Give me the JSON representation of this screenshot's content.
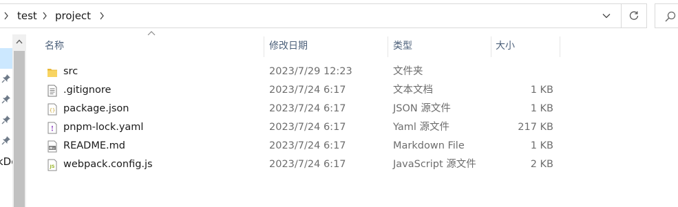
{
  "breadcrumb": {
    "items": [
      "test",
      "project"
    ]
  },
  "columns": {
    "name": "名称",
    "date_modified": "修改日期",
    "type": "类型",
    "size": "大小"
  },
  "nav": {
    "partial_label": "kDo"
  },
  "files": [
    {
      "name": "src",
      "date": "2023/7/29 12:23",
      "type": "文件夹",
      "size": "",
      "icon": "folder-icon"
    },
    {
      "name": ".gitignore",
      "date": "2023/7/24 6:17",
      "type": "文本文档",
      "size": "1 KB",
      "icon": "text-file-icon"
    },
    {
      "name": "package.json",
      "date": "2023/7/24 6:17",
      "type": "JSON 源文件",
      "size": "1 KB",
      "icon": "json-file-icon"
    },
    {
      "name": "pnpm-lock.yaml",
      "date": "2023/7/24 6:17",
      "type": "Yaml 源文件",
      "size": "217 KB",
      "icon": "yaml-file-icon"
    },
    {
      "name": "README.md",
      "date": "2023/7/24 6:17",
      "type": "Markdown File",
      "size": "1 KB",
      "icon": "markdown-file-icon"
    },
    {
      "name": "webpack.config.js",
      "date": "2023/7/24 6:17",
      "type": "JavaScript 源文件",
      "size": "2 KB",
      "icon": "javascript-file-icon"
    }
  ],
  "colors": {
    "header_text": "#4c607a",
    "secondary_text": "#6d6d6d",
    "folder_yellow": "#f4c542",
    "nav_selected": "#cce8ff",
    "border": "#d9d9d9"
  }
}
